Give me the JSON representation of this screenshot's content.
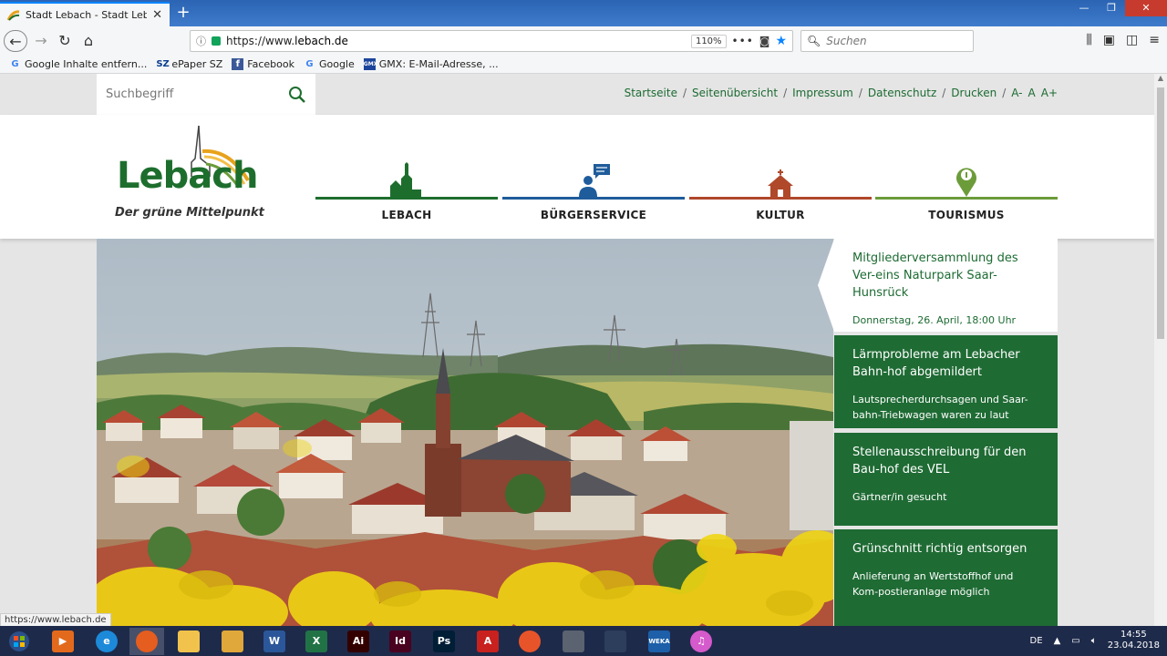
{
  "browser": {
    "tab_title": "Stadt Lebach - Stadt Lebach",
    "new_tab": "+",
    "url_prefix": "https://www.",
    "url_domain": "lebach.de",
    "zoom": "110%",
    "more": "•••",
    "search_placeholder": "Suchen",
    "status_url": "https://www.lebach.de",
    "bookmarks": [
      {
        "label": "Google Inhalte entfern...",
        "icon": "G"
      },
      {
        "label": "ePaper SZ",
        "icon": "SZ"
      },
      {
        "label": "Facebook",
        "icon": "f"
      },
      {
        "label": "Google",
        "icon": "G"
      },
      {
        "label": "GMX: E-Mail-Adresse, ...",
        "icon": "GMX"
      }
    ]
  },
  "site": {
    "search_placeholder": "Suchbegriff",
    "top_links": [
      "Startseite",
      "Seitenübersicht",
      "Impressum",
      "Datenschutz",
      "Drucken"
    ],
    "font_sizes": [
      "A-",
      "A",
      "A+"
    ],
    "logo_word": "Lebach",
    "logo_tagline": "Der grüne Mittelpunkt",
    "nav": [
      {
        "label": "LEBACH",
        "color": "#1d6e2d"
      },
      {
        "label": "BÜRGERSERVICE",
        "color": "#1f5c9b"
      },
      {
        "label": "KULTUR",
        "color": "#b0482a"
      },
      {
        "label": "TOURISMUS",
        "color": "#6c9c3a"
      }
    ],
    "news": [
      {
        "title": "Mitgliederversammlung des Ver-eins Naturpark Saar-Hunsrück",
        "desc": "Donnerstag, 26. April, 18:00 Uhr"
      },
      {
        "title": "Lärmprobleme am Lebacher Bahn-hof abgemildert",
        "desc": "Lautsprecherdurchsagen und Saar-bahn-Triebwagen waren zu laut"
      },
      {
        "title": "Stellenausschreibung für den Bau-hof des VEL",
        "desc": "Gärtner/in gesucht"
      },
      {
        "title": "Grünschnitt richtig entsorgen",
        "desc": "Anlieferung an Wertstoffhof und Kom-postieranlage möglich"
      }
    ]
  },
  "taskbar": {
    "lang": "DE",
    "time": "14:55",
    "date": "23.04.2018",
    "apps": [
      {
        "name": "media-player",
        "label": "▶",
        "color": "#e36a1c"
      },
      {
        "name": "internet-explorer",
        "label": "e",
        "color": "#1c8ad8"
      },
      {
        "name": "firefox",
        "label": "",
        "color": "#e55d1f"
      },
      {
        "name": "file-explorer",
        "label": "",
        "color": "#f1c34d"
      },
      {
        "name": "outlook",
        "label": "",
        "color": "#e0a73a"
      },
      {
        "name": "word",
        "label": "W",
        "color": "#2b579a"
      },
      {
        "name": "excel",
        "label": "X",
        "color": "#217346"
      },
      {
        "name": "illustrator",
        "label": "Ai",
        "color": "#330000"
      },
      {
        "name": "indesign",
        "label": "Id",
        "color": "#49021f"
      },
      {
        "name": "photoshop",
        "label": "Ps",
        "color": "#001e36"
      },
      {
        "name": "acrobat",
        "label": "A",
        "color": "#c9211e"
      },
      {
        "name": "balloon-app",
        "label": "",
        "color": "#e8542a"
      },
      {
        "name": "camera-app",
        "label": "",
        "color": "#5b6270"
      },
      {
        "name": "mountain-app",
        "label": "",
        "color": "#2d3e5c"
      },
      {
        "name": "weka",
        "label": "WEKA",
        "color": "#1d5fa8"
      },
      {
        "name": "itunes",
        "label": "♫",
        "color": "#d55acb"
      }
    ]
  }
}
